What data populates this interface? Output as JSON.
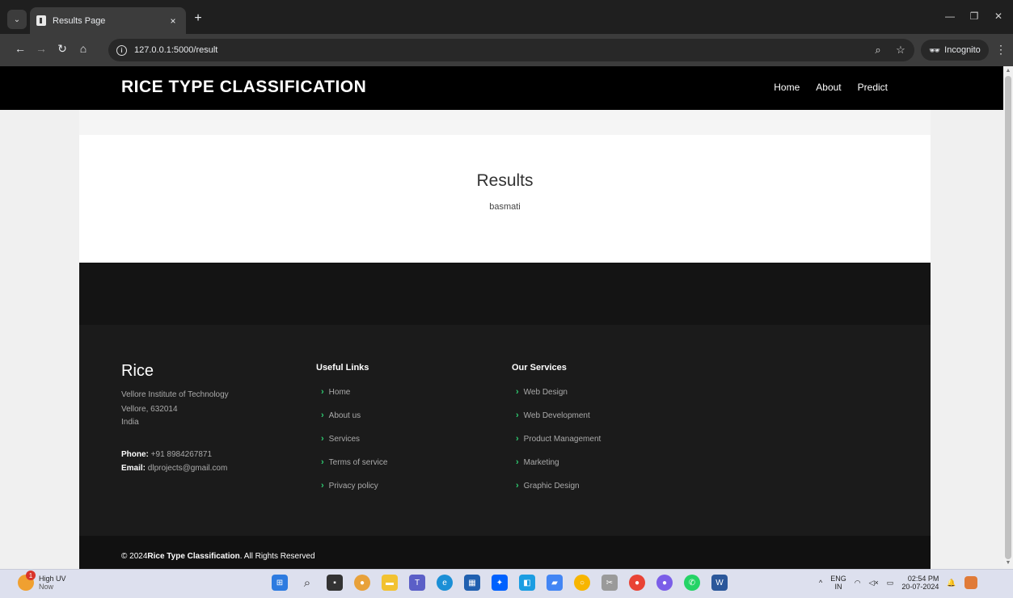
{
  "browser": {
    "tab_title": "Results Page",
    "tab_close": "×",
    "new_tab": "+",
    "url": "127.0.0.1:5000/result",
    "incognito_label": "Incognito"
  },
  "site": {
    "brand": "RICE TYPE CLASSIFICATION",
    "nav": [
      "Home",
      "About",
      "Predict"
    ]
  },
  "results": {
    "title": "Results",
    "value": "basmati"
  },
  "footer": {
    "brand": "Rice",
    "address": [
      "Vellore Institute of Technology",
      "Vellore, 632014",
      "India"
    ],
    "phone_label": "Phone:",
    "phone": " +91 8984267871",
    "email_label": "Email:",
    "email": " dlprojects@gmail.com",
    "useful_links_heading": "Useful Links",
    "useful_links": [
      "Home",
      "About us",
      "Services",
      "Terms of service",
      "Privacy policy"
    ],
    "services_heading": "Our Services",
    "services": [
      "Web Design",
      "Web Development",
      "Product Management",
      "Marketing",
      "Graphic Design"
    ],
    "copyright_prefix": "© 2024",
    "copyright_brand": "Rice Type Classification",
    "copyright_suffix": ". All Rights Reserved"
  },
  "taskbar": {
    "weather_title": "High UV",
    "weather_sub": "Now",
    "weather_badge": "1",
    "lang_top": "ENG",
    "lang_bottom": "IN",
    "time": "02:54 PM",
    "date": "20-07-2024"
  },
  "colors": {
    "accent_green": "#2ecc71",
    "header_bg": "#000000",
    "footer_bg": "#1b1b1b"
  }
}
